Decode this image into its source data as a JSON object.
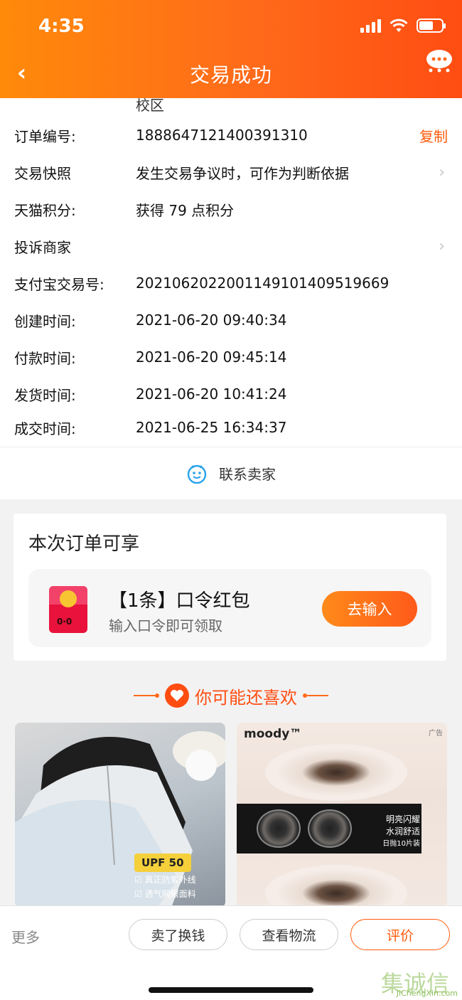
{
  "status_bar": {
    "time": "4:35"
  },
  "header": {
    "title": "交易成功",
    "back": "‹"
  },
  "order_info": {
    "partial_top": "校区",
    "rows": [
      {
        "label": "订单编号:",
        "value": "1888647121400391310",
        "action": "复制"
      },
      {
        "label": "交易快照",
        "value": "发生交易争议时，可作为判断依据",
        "chevron": "›"
      },
      {
        "label": "天猫积分:",
        "value": "获得 79 点积分"
      },
      {
        "label": "投诉商家",
        "value": "",
        "chevron": "›"
      },
      {
        "label": "支付宝交易号:",
        "value": "2021062022001149101409519669"
      },
      {
        "label": "创建时间:",
        "value": "2021-06-20 09:40:34"
      },
      {
        "label": "付款时间:",
        "value": "2021-06-20 09:45:14"
      },
      {
        "label": "发货时间:",
        "value": "2021-06-20 10:41:24"
      },
      {
        "label": "成交时间:",
        "value": "2021-06-25 16:34:37"
      }
    ],
    "contact_label": "联系卖家"
  },
  "promo": {
    "title": "本次订单可享",
    "coupon_title": "【1条】口令红包",
    "coupon_sub": "输入口令即可领取",
    "coupon_button": "去输入",
    "envelope_face": "0·0"
  },
  "recommend": {
    "heading": "你可能还喜欢",
    "products": [
      {
        "badge": "UPF 50",
        "features": [
          "☑ 真正防紫外线",
          "☑ 透气网眼面料"
        ]
      },
      {
        "brand": "moody™",
        "ad": "广告",
        "tagline_1": "明亮闪耀",
        "tagline_2": "水润舒适",
        "tagline_3": "日抛10片装"
      }
    ]
  },
  "bottom_bar": {
    "more": "更多",
    "sell": "卖了换钱",
    "track": "查看物流",
    "review": "评价"
  },
  "watermark": {
    "text": "JiChengXin.com",
    "big": "集诚信"
  },
  "colors": {
    "accent": "#ff5a0a",
    "header_start": "#ff8a0a",
    "header_end": "#ff4d12"
  }
}
